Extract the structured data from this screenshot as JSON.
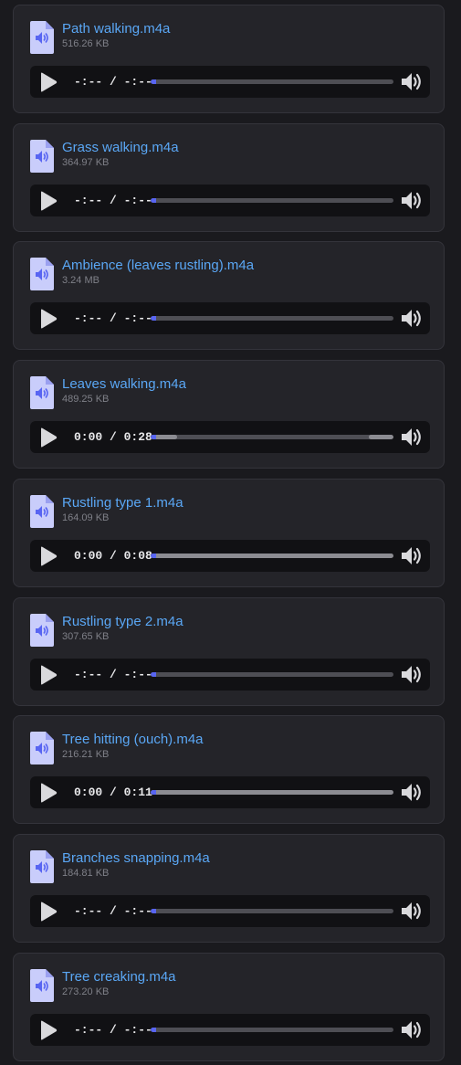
{
  "colors": {
    "background": "#1a1a1e",
    "card": "#242429",
    "filename_link": "#5aa7f5",
    "file_size": "#7f8088",
    "player_bg": "#111114",
    "progress_accent": "#5865f2",
    "track": "#4e4e54",
    "track_loaded": "#8c8c92",
    "file_icon": "#c9cdfb"
  },
  "icons": {
    "file": "audio-file-icon",
    "play": "play-icon",
    "volume": "volume-icon"
  },
  "attachments": [
    {
      "name": "Path walking.m4a",
      "size": "516.26 KB",
      "time": "-:--",
      "duration": "-:--",
      "loaded": false,
      "buffered": 0
    },
    {
      "name": "Grass walking.m4a",
      "size": "364.97 KB",
      "time": "-:--",
      "duration": "-:--",
      "loaded": false,
      "buffered": 0
    },
    {
      "name": "Ambience (leaves rustling).m4a",
      "size": "3.24 MB",
      "time": "-:--",
      "duration": "-:--",
      "loaded": false,
      "buffered": 0
    },
    {
      "name": "Leaves walking.m4a",
      "size": "489.25 KB",
      "time": "0:00",
      "duration": "0:28",
      "loaded": false,
      "buffered": 0.11,
      "buffered_end": 0.1
    },
    {
      "name": "Rustling type 1.m4a",
      "size": "164.09 KB",
      "time": "0:00",
      "duration": "0:08",
      "loaded": true,
      "buffered": 1
    },
    {
      "name": "Rustling type 2.m4a",
      "size": "307.65 KB",
      "time": "-:--",
      "duration": "-:--",
      "loaded": false,
      "buffered": 0
    },
    {
      "name": "Tree hitting (ouch).m4a",
      "size": "216.21 KB",
      "time": "0:00",
      "duration": "0:11",
      "loaded": true,
      "buffered": 1
    },
    {
      "name": "Branches snapping.m4a",
      "size": "184.81 KB",
      "time": "-:--",
      "duration": "-:--",
      "loaded": false,
      "buffered": 0
    },
    {
      "name": "Tree creaking.m4a",
      "size": "273.20 KB",
      "time": "-:--",
      "duration": "-:--",
      "loaded": false,
      "buffered": 0
    }
  ]
}
